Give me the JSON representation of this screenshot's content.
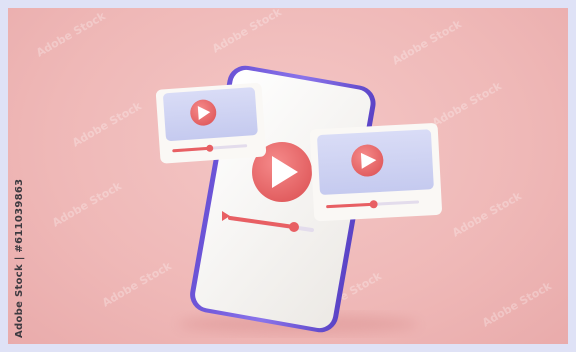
{
  "image": {
    "subject": "3D smartphone with video player windows",
    "credit_text": "Adobe Stock | #611039863",
    "watermark_text": "Adobe Stock"
  },
  "colors": {
    "background": "#efb8b7",
    "frame": "#dfe2f6",
    "phone_body": "#7b63e0",
    "phone_screen": "#f7f5f2",
    "play_button": "#ec6b6b",
    "video_panel": "#cfd3f2",
    "card": "#faf8f5",
    "slider_fill": "#e85f63"
  }
}
